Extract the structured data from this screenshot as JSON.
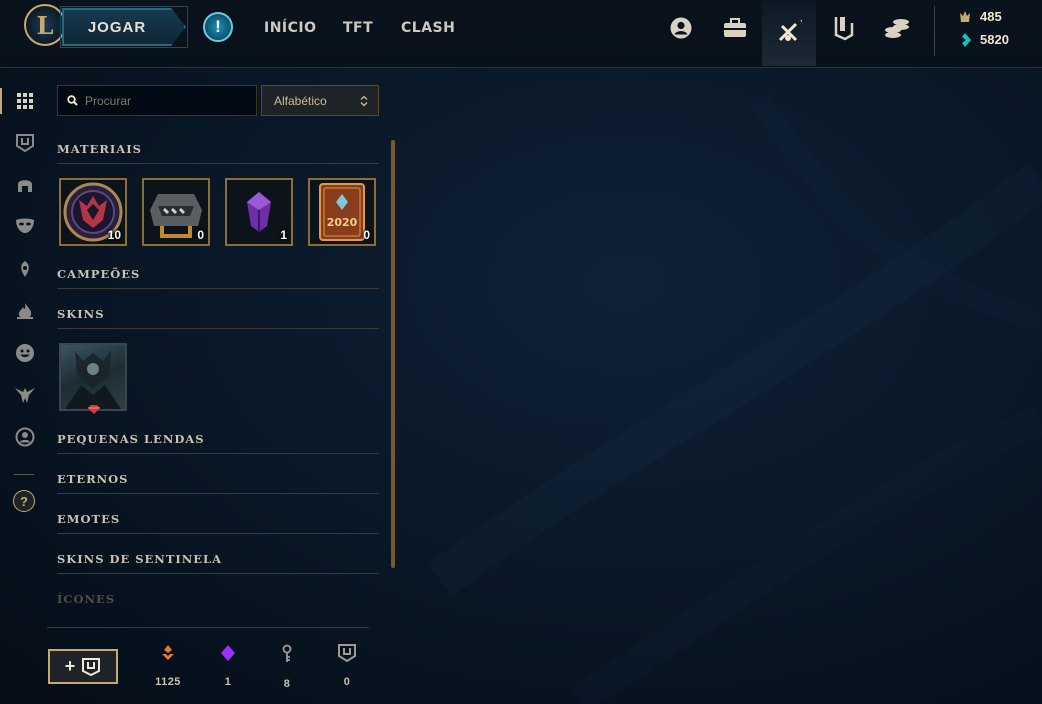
{
  "topbar": {
    "logo_letter": "L",
    "play_label": "JOGAR",
    "alert_symbol": "!",
    "nav": [
      {
        "label": "INÍCIO"
      },
      {
        "label": "TFT"
      },
      {
        "label": "CLASH"
      }
    ],
    "icons": [
      "profile-icon",
      "collection-icon",
      "loot-icon",
      "store-icon",
      "currency-stack-icon"
    ],
    "active_icon": "loot-icon",
    "currencies": [
      {
        "icon": "blue-essence-icon",
        "value": "485",
        "color": "#c8aa6e"
      },
      {
        "icon": "riot-points-icon",
        "value": "5820",
        "color": "#0ac8b9"
      }
    ]
  },
  "rail": {
    "items": [
      "all-grid-icon",
      "chest-icon",
      "helmet-icon",
      "mask-icon",
      "ward-icon",
      "flame-icon",
      "emote-icon",
      "crest-icon",
      "profile-circle-icon"
    ],
    "active": "all-grid-icon",
    "help_symbol": "?"
  },
  "search": {
    "placeholder": "Procurar",
    "value": ""
  },
  "sort": {
    "selected": "Alfabético"
  },
  "sections": {
    "materials": "MATERIAIS",
    "champions": "CAMPEÕES",
    "skins": "SKINS",
    "little_legends": "PEQUENAS LENDAS",
    "eternals": "ETERNOS",
    "emotes": "EMOTES",
    "ward_skins": "SKINS DE SENTINELA",
    "icons": "ÍCONES"
  },
  "materials": [
    {
      "name": "worlds-token",
      "count": "10"
    },
    {
      "name": "hextech-chest",
      "count": "0"
    },
    {
      "name": "purple-crystal",
      "count": "1"
    },
    {
      "name": "2020-card",
      "count": "0",
      "label": "2020"
    }
  ],
  "footer": {
    "add_label": "+",
    "stats": [
      {
        "icon": "orange-essence-icon",
        "value": "1125",
        "color": "#e07a2e"
      },
      {
        "icon": "mythic-essence-icon",
        "value": "1",
        "color": "#9b30ff"
      },
      {
        "icon": "key-fragment-icon",
        "value": "8",
        "color": "#a09b8c"
      },
      {
        "icon": "chest-count-icon",
        "value": "0",
        "color": "#a09b8c"
      }
    ]
  }
}
